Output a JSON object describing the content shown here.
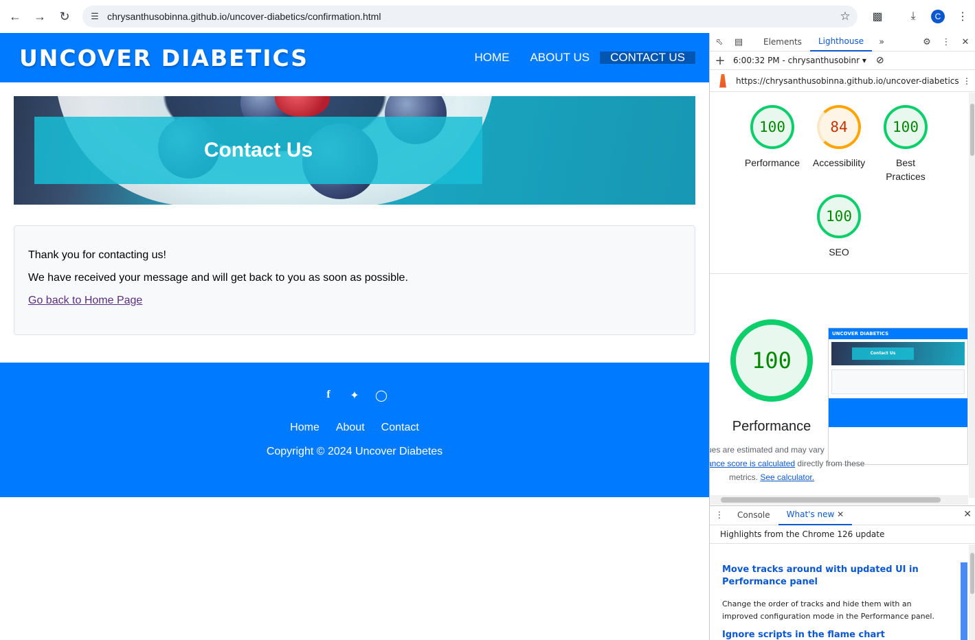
{
  "browser": {
    "url": "chrysanthusobinna.github.io/uncover-diabetics/confirmation.html",
    "profile_initial": "C",
    "icons": [
      "back-icon",
      "forward-icon",
      "reload-icon",
      "site-info-icon",
      "star-icon",
      "extensions-icon",
      "download-icon",
      "menu-icon"
    ]
  },
  "site": {
    "logo": "UNCOVER DIABETICS",
    "nav": [
      "HOME",
      "ABOUT US",
      "CONTACT US"
    ],
    "active_nav": "CONTACT US",
    "hero_title": "Contact Us",
    "message_line1": "Thank you for contacting us!",
    "message_line2": "We have received your message and will get back to you as soon as possible.",
    "home_link": "Go back to Home Page",
    "footer_links": [
      "Home",
      "About",
      "Contact"
    ],
    "copyright": "Copyright © 2024 Uncover Diabetes",
    "social_icons": [
      "facebook-icon",
      "twitter-icon",
      "instagram-icon"
    ],
    "colors": {
      "brand_blue": "#007bff",
      "active_nav": "#0056b3",
      "visited_link": "#5a2d82"
    }
  },
  "devtools": {
    "tabs": [
      "Elements",
      "Lighthouse"
    ],
    "active_tab": "Lighthouse",
    "report_selector": "6:00:32 PM - chrysanthusobinr",
    "report_url": "https://chrysanthusobinna.github.io/uncover-diabetics/co...",
    "scores": [
      {
        "label": "Performance",
        "value": "100",
        "status": "pass"
      },
      {
        "label": "Accessibility",
        "value": "84",
        "status": "average"
      },
      {
        "label": "Best Practices",
        "value": "100",
        "status": "pass"
      },
      {
        "label": "SEO",
        "value": "100",
        "status": "pass"
      }
    ],
    "big_score": "100",
    "big_label": "Performance",
    "thumb_logo": "UNCOVER DIABETICS",
    "thumb_hero": "Contact Us",
    "note_line1": "ues are estimated and may vary",
    "note_link1": "ance score is calculated",
    "note_line2_rest": " directly from these",
    "note_line3": "metrics. ",
    "note_link2": "See calculator.",
    "drawer_tabs": [
      "Console",
      "What's new"
    ],
    "drawer_active": "What's new",
    "highlights": "Highlights from the Chrome 126 update",
    "wn_title": "Move tracks around with updated UI in Performance panel",
    "wn_desc": "Change the order of tracks and hide them with an improved configuration mode in the Performance panel.",
    "wn_title2": "Ignore scripts in the flame chart"
  }
}
